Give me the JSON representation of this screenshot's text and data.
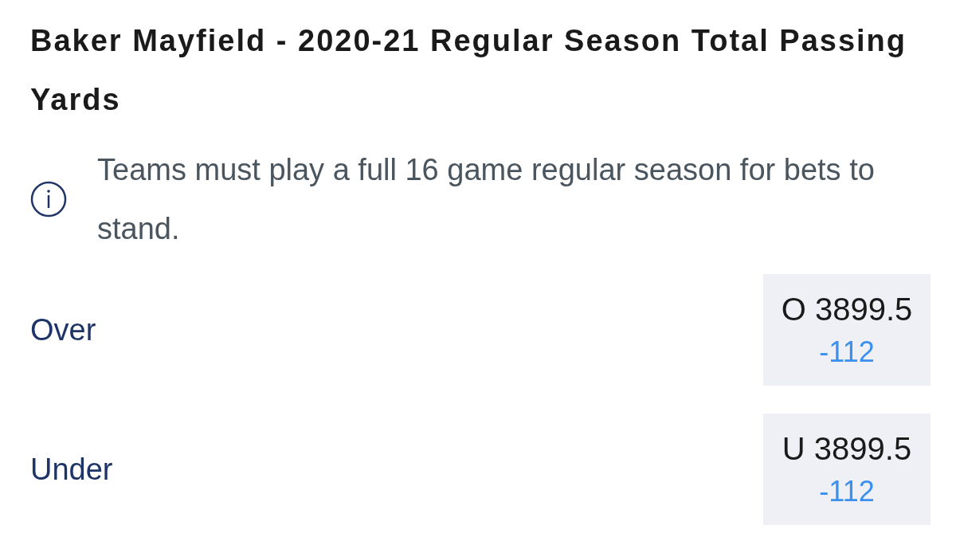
{
  "title": "Baker Mayfield - 2020-21 Regular Season Total Passing Yards",
  "notice": {
    "text": "Teams must play a full 16 game regular season for bets to stand."
  },
  "options": [
    {
      "label": "Over",
      "line": "O 3899.5",
      "odds": "-112"
    },
    {
      "label": "Under",
      "line": "U 3899.5",
      "odds": "-112"
    }
  ]
}
